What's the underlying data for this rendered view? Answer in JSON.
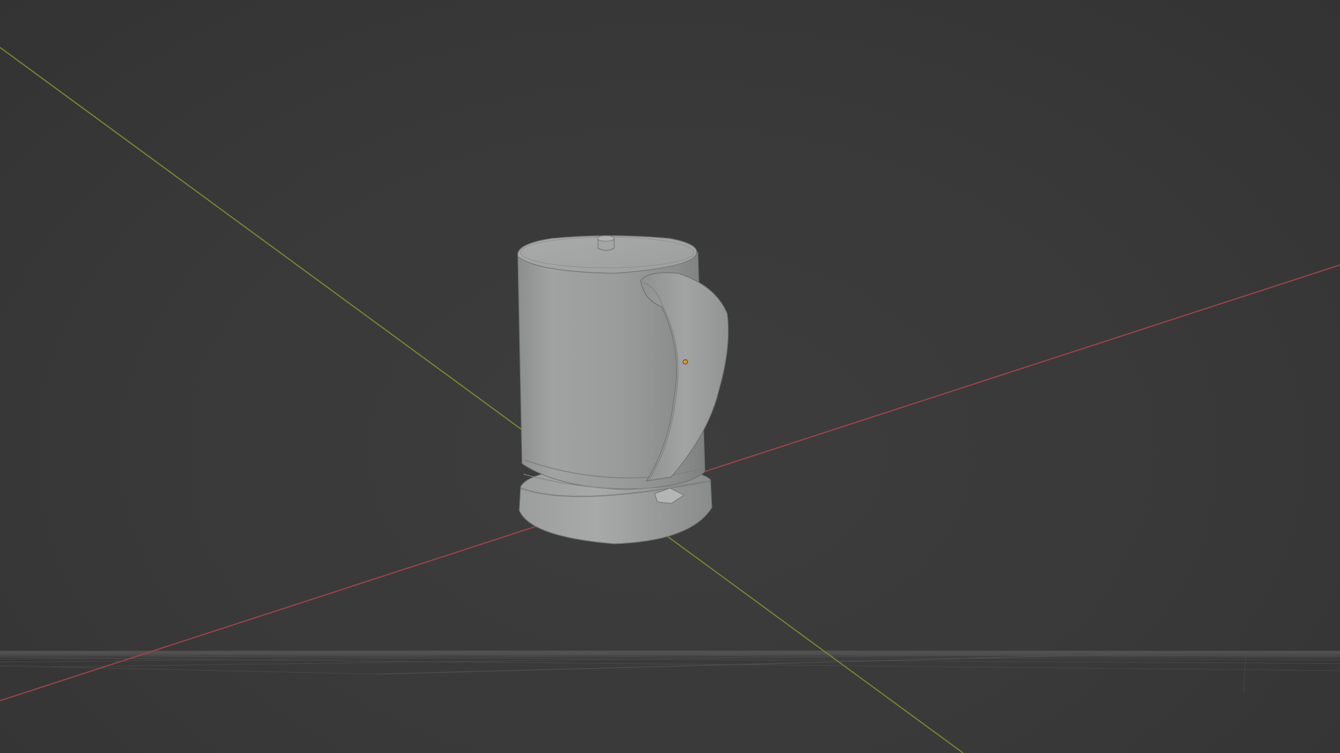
{
  "viewport": {
    "background_color": "#3b3b3b",
    "grid_color": "#545454",
    "x_axis_color": "#a8434b",
    "y_axis_color": "#7c8d2c",
    "origin_marker_color": "#e89a2c"
  },
  "scene": {
    "object": "kettle",
    "shading": "solid-gray",
    "body_color": "#9a9c9b"
  }
}
